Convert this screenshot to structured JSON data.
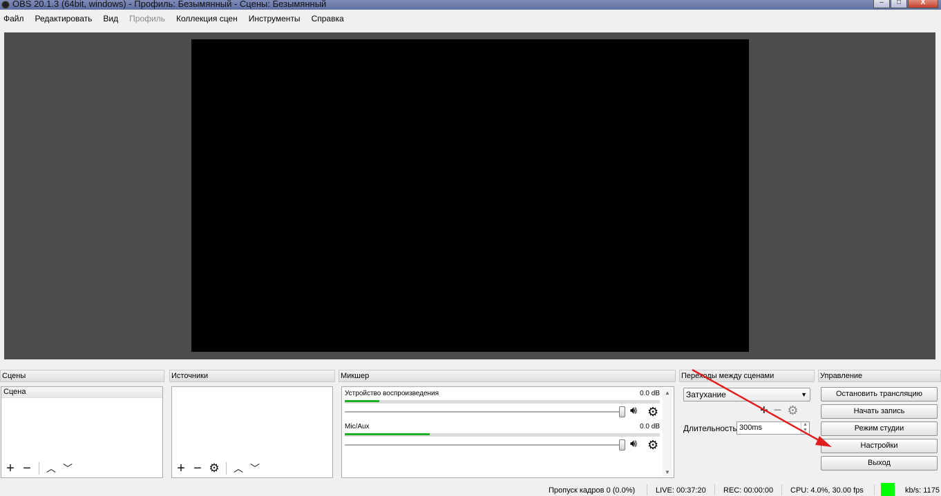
{
  "window": {
    "title": "OBS 20.1.3 (64bit, windows) - Профиль: Безымянный - Сцены: Безымянный",
    "minimize": "–",
    "maximize": "□",
    "close": "X"
  },
  "menu": [
    "Файл",
    "Редактировать",
    "Вид",
    "Профиль",
    "Коллекция сцен",
    "Инструменты",
    "Справка"
  ],
  "scenes": {
    "title": "Сцены",
    "items": [
      "Сцена"
    ]
  },
  "sources": {
    "title": "Источники"
  },
  "mixer": {
    "title": "Микшер",
    "channels": [
      {
        "name": "Устройство воспроизведения",
        "db": "0.0 dB",
        "level": 0.11
      },
      {
        "name": "Mic/Aux",
        "db": "0.0 dB",
        "level": 0.27
      }
    ]
  },
  "transitions": {
    "title": "Переходы между сценами",
    "selected": "Затухание",
    "duration_label": "Длительность",
    "duration_value": "300ms"
  },
  "controls": {
    "title": "Управление",
    "buttons": [
      "Остановить трансляцию",
      "Начать запись",
      "Режим студии",
      "Настройки",
      "Выход"
    ]
  },
  "status": {
    "dropped": "Пропуск кадров 0 (0.0%)",
    "live": "LIVE: 00:37:20",
    "rec": "REC: 00:00:00",
    "cpu": "CPU: 4.0%, 30.00 fps",
    "kbs": "kb/s: 1175"
  },
  "colors": {
    "accent_status": "#00ff00",
    "annotation_arrow": "#e02020"
  }
}
